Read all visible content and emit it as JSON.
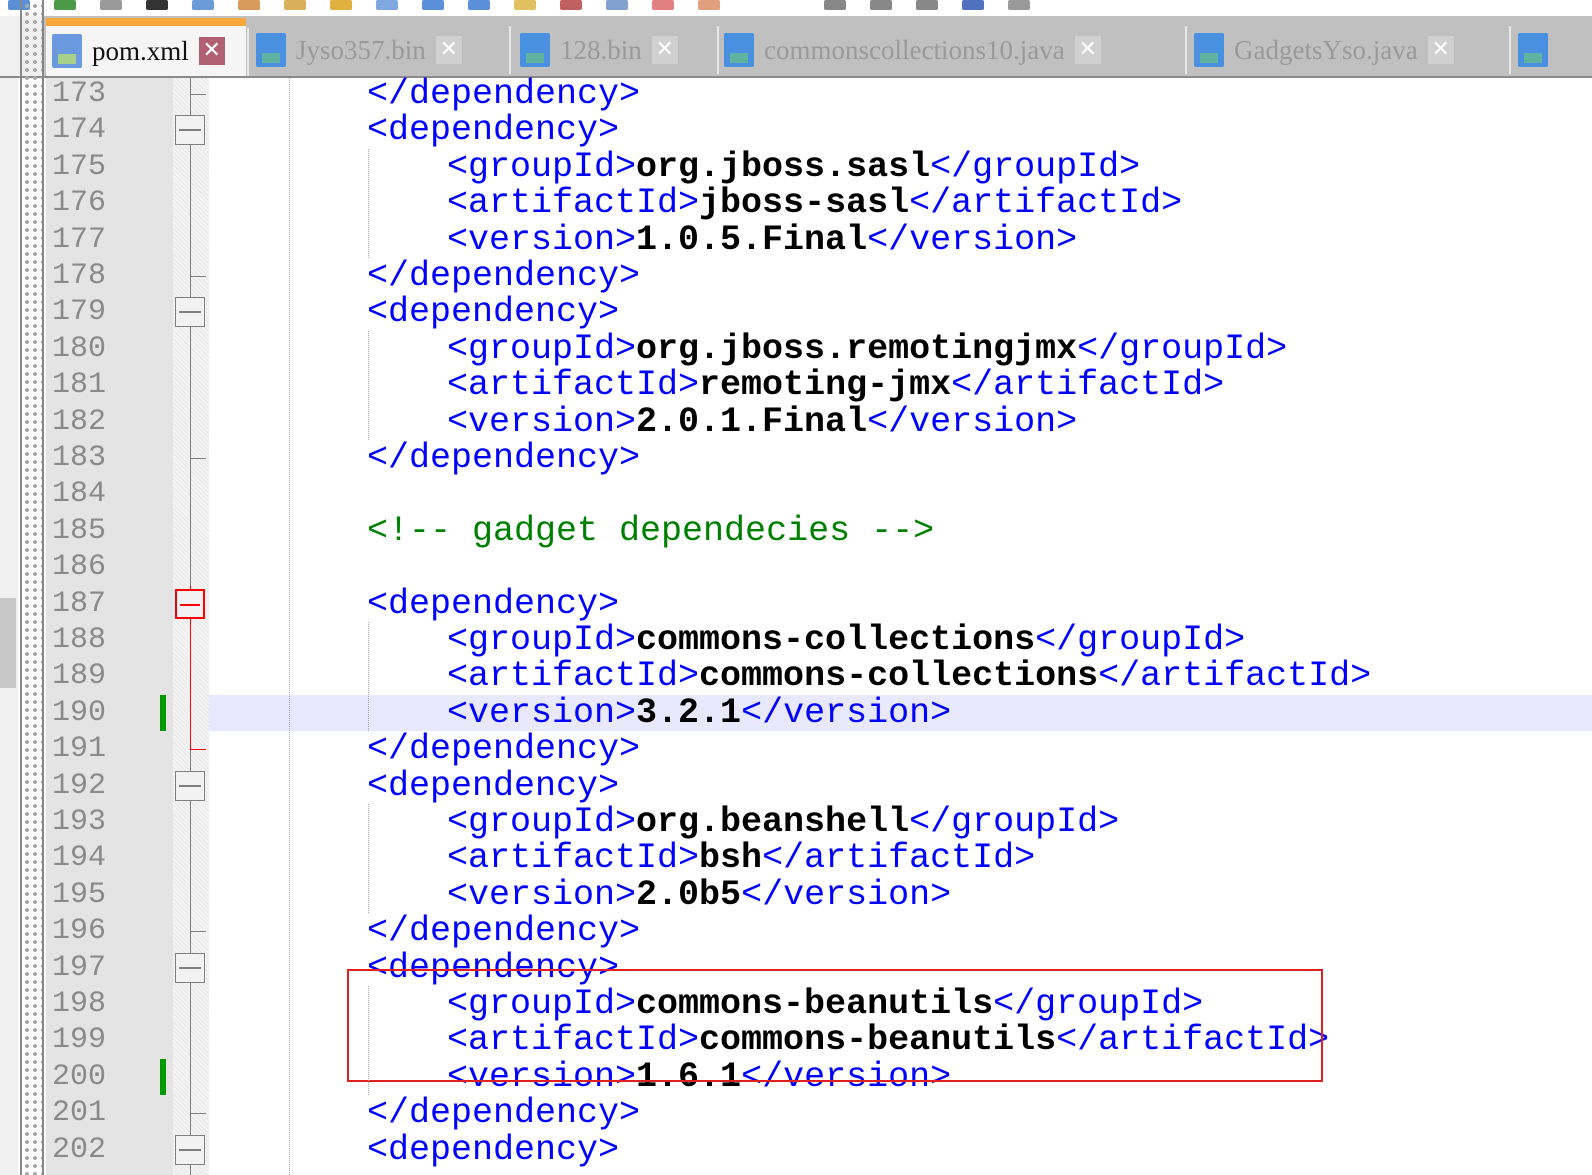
{
  "tabs": [
    {
      "label": "pom.xml",
      "active": true
    },
    {
      "label": "Jyso357.bin",
      "active": false
    },
    {
      "label": "128.bin",
      "active": false
    },
    {
      "label": "commonscollections10.java",
      "active": false
    },
    {
      "label": "GadgetsYso.java",
      "active": false
    }
  ],
  "icons": {
    "tab_file": "floppy-disk-icon",
    "tab_close": "close-x-icon",
    "close_glyph": "✕"
  },
  "colors": {
    "tag": "#0000ff",
    "text": "#000000",
    "comment": "#008000",
    "current_line": "#e8e8ff",
    "highlight_box": "#e02020",
    "change_marker": "#009900"
  },
  "editor": {
    "current_line": 190,
    "changed_lines": [
      190,
      200
    ],
    "fold_open": [
      174,
      179,
      187,
      192,
      197,
      202
    ],
    "fold_end": [
      173,
      178,
      183,
      191,
      196,
      201
    ],
    "active_fold": 187,
    "lines": [
      {
        "num": "173",
        "indent": 2,
        "parts": [
          [
            "tag",
            "</dependency>"
          ]
        ]
      },
      {
        "num": "174",
        "indent": 2,
        "parts": [
          [
            "tag",
            "<dependency>"
          ]
        ]
      },
      {
        "num": "175",
        "indent": 3,
        "parts": [
          [
            "tag",
            "<groupId>"
          ],
          [
            "txt",
            "org.jboss.sasl"
          ],
          [
            "tag",
            "</groupId>"
          ]
        ]
      },
      {
        "num": "176",
        "indent": 3,
        "parts": [
          [
            "tag",
            "<artifactId>"
          ],
          [
            "txt",
            "jboss-sasl"
          ],
          [
            "tag",
            "</artifactId>"
          ]
        ]
      },
      {
        "num": "177",
        "indent": 3,
        "parts": [
          [
            "tag",
            "<version>"
          ],
          [
            "txt",
            "1.0.5.Final"
          ],
          [
            "tag",
            "</version>"
          ]
        ]
      },
      {
        "num": "178",
        "indent": 2,
        "parts": [
          [
            "tag",
            "</dependency>"
          ]
        ]
      },
      {
        "num": "179",
        "indent": 2,
        "parts": [
          [
            "tag",
            "<dependency>"
          ]
        ]
      },
      {
        "num": "180",
        "indent": 3,
        "parts": [
          [
            "tag",
            "<groupId>"
          ],
          [
            "txt",
            "org.jboss.remotingjmx"
          ],
          [
            "tag",
            "</groupId>"
          ]
        ]
      },
      {
        "num": "181",
        "indent": 3,
        "parts": [
          [
            "tag",
            "<artifactId>"
          ],
          [
            "txt",
            "remoting-jmx"
          ],
          [
            "tag",
            "</artifactId>"
          ]
        ]
      },
      {
        "num": "182",
        "indent": 3,
        "parts": [
          [
            "tag",
            "<version>"
          ],
          [
            "txt",
            "2.0.1.Final"
          ],
          [
            "tag",
            "</version>"
          ]
        ]
      },
      {
        "num": "183",
        "indent": 2,
        "parts": [
          [
            "tag",
            "</dependency>"
          ]
        ]
      },
      {
        "num": "184",
        "indent": 0,
        "parts": []
      },
      {
        "num": "185",
        "indent": 2,
        "parts": [
          [
            "cmt",
            "<!-- gadget dependecies -->"
          ]
        ]
      },
      {
        "num": "186",
        "indent": 0,
        "parts": []
      },
      {
        "num": "187",
        "indent": 2,
        "parts": [
          [
            "tag",
            "<dependency>"
          ]
        ]
      },
      {
        "num": "188",
        "indent": 3,
        "parts": [
          [
            "tag",
            "<groupId>"
          ],
          [
            "txt",
            "commons-collections"
          ],
          [
            "tag",
            "</groupId>"
          ]
        ]
      },
      {
        "num": "189",
        "indent": 3,
        "parts": [
          [
            "tag",
            "<artifactId>"
          ],
          [
            "txt",
            "commons-collections"
          ],
          [
            "tag",
            "</artifactId>"
          ]
        ]
      },
      {
        "num": "190",
        "indent": 3,
        "parts": [
          [
            "tag",
            "<version>"
          ],
          [
            "txt",
            "3.2.1"
          ],
          [
            "tag",
            "</version>"
          ]
        ]
      },
      {
        "num": "191",
        "indent": 2,
        "parts": [
          [
            "tag",
            "</dependency>"
          ]
        ]
      },
      {
        "num": "192",
        "indent": 2,
        "parts": [
          [
            "tag",
            "<dependency>"
          ]
        ]
      },
      {
        "num": "193",
        "indent": 3,
        "parts": [
          [
            "tag",
            "<groupId>"
          ],
          [
            "txt",
            "org.beanshell"
          ],
          [
            "tag",
            "</groupId>"
          ]
        ]
      },
      {
        "num": "194",
        "indent": 3,
        "parts": [
          [
            "tag",
            "<artifactId>"
          ],
          [
            "txt",
            "bsh"
          ],
          [
            "tag",
            "</artifactId>"
          ]
        ]
      },
      {
        "num": "195",
        "indent": 3,
        "parts": [
          [
            "tag",
            "<version>"
          ],
          [
            "txt",
            "2.0b5"
          ],
          [
            "tag",
            "</version>"
          ]
        ]
      },
      {
        "num": "196",
        "indent": 2,
        "parts": [
          [
            "tag",
            "</dependency>"
          ]
        ]
      },
      {
        "num": "197",
        "indent": 2,
        "parts": [
          [
            "tag",
            "<dependency>"
          ]
        ]
      },
      {
        "num": "198",
        "indent": 3,
        "parts": [
          [
            "tag",
            "<groupId>"
          ],
          [
            "txt",
            "commons-beanutils"
          ],
          [
            "tag",
            "</groupId>"
          ]
        ]
      },
      {
        "num": "199",
        "indent": 3,
        "parts": [
          [
            "tag",
            "<artifactId>"
          ],
          [
            "txt",
            "commons-beanutils"
          ],
          [
            "tag",
            "</artifactId>"
          ]
        ]
      },
      {
        "num": "200",
        "indent": 3,
        "parts": [
          [
            "tag",
            "<version>"
          ],
          [
            "txt",
            "1.6.1"
          ],
          [
            "tag",
            "</version>"
          ]
        ]
      },
      {
        "num": "201",
        "indent": 2,
        "parts": [
          [
            "tag",
            "</dependency>"
          ]
        ]
      },
      {
        "num": "202",
        "indent": 2,
        "parts": [
          [
            "tag",
            "<dependency>"
          ]
        ]
      }
    ]
  }
}
